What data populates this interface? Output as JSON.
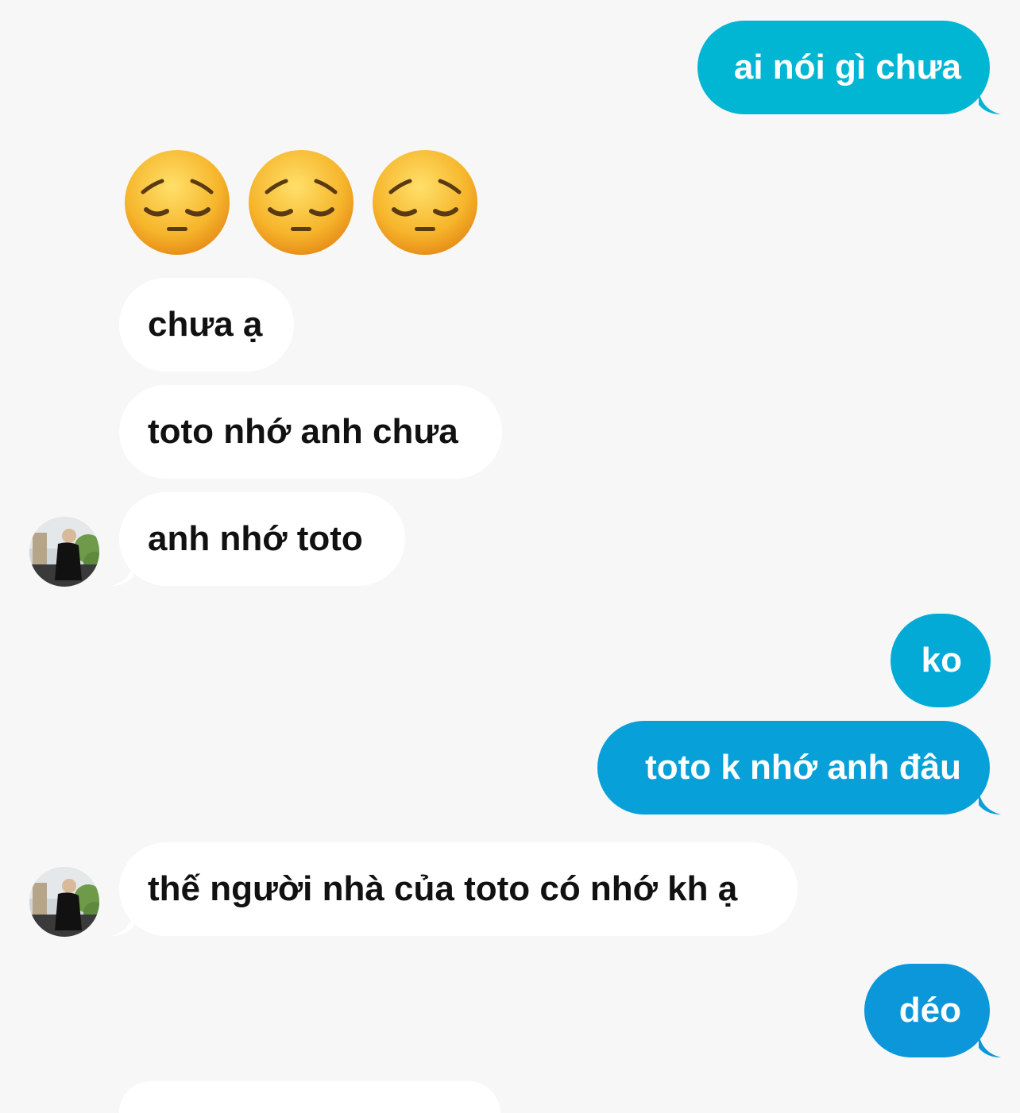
{
  "colors": {
    "background": "#f7f7f7",
    "outgoing_bubble_top": "#00b6d3",
    "outgoing_bubble_mid": "#05a4d6",
    "outgoing_bubble_bottom": "#0c97da",
    "incoming_bubble": "#ffffff",
    "incoming_text": "#111111",
    "outgoing_text": "#ffffff"
  },
  "messages": [
    {
      "direction": "out",
      "text": "ai nói gì chưa"
    },
    {
      "direction": "in",
      "type": "emoji",
      "emoji_name": "pensive-face",
      "count": 3
    },
    {
      "direction": "in",
      "text": "chưa ạ"
    },
    {
      "direction": "in",
      "text": "toto nhớ anh chưa"
    },
    {
      "direction": "in",
      "text": "anh nhớ toto",
      "avatar": "sender-avatar-icon"
    },
    {
      "direction": "out",
      "text": "ko"
    },
    {
      "direction": "out",
      "text": "toto k nhớ anh đâu"
    },
    {
      "direction": "in",
      "text": "thế người nhà của toto có nhớ kh ạ",
      "avatar": "sender-avatar-icon"
    },
    {
      "direction": "out",
      "text": "déo"
    }
  ]
}
